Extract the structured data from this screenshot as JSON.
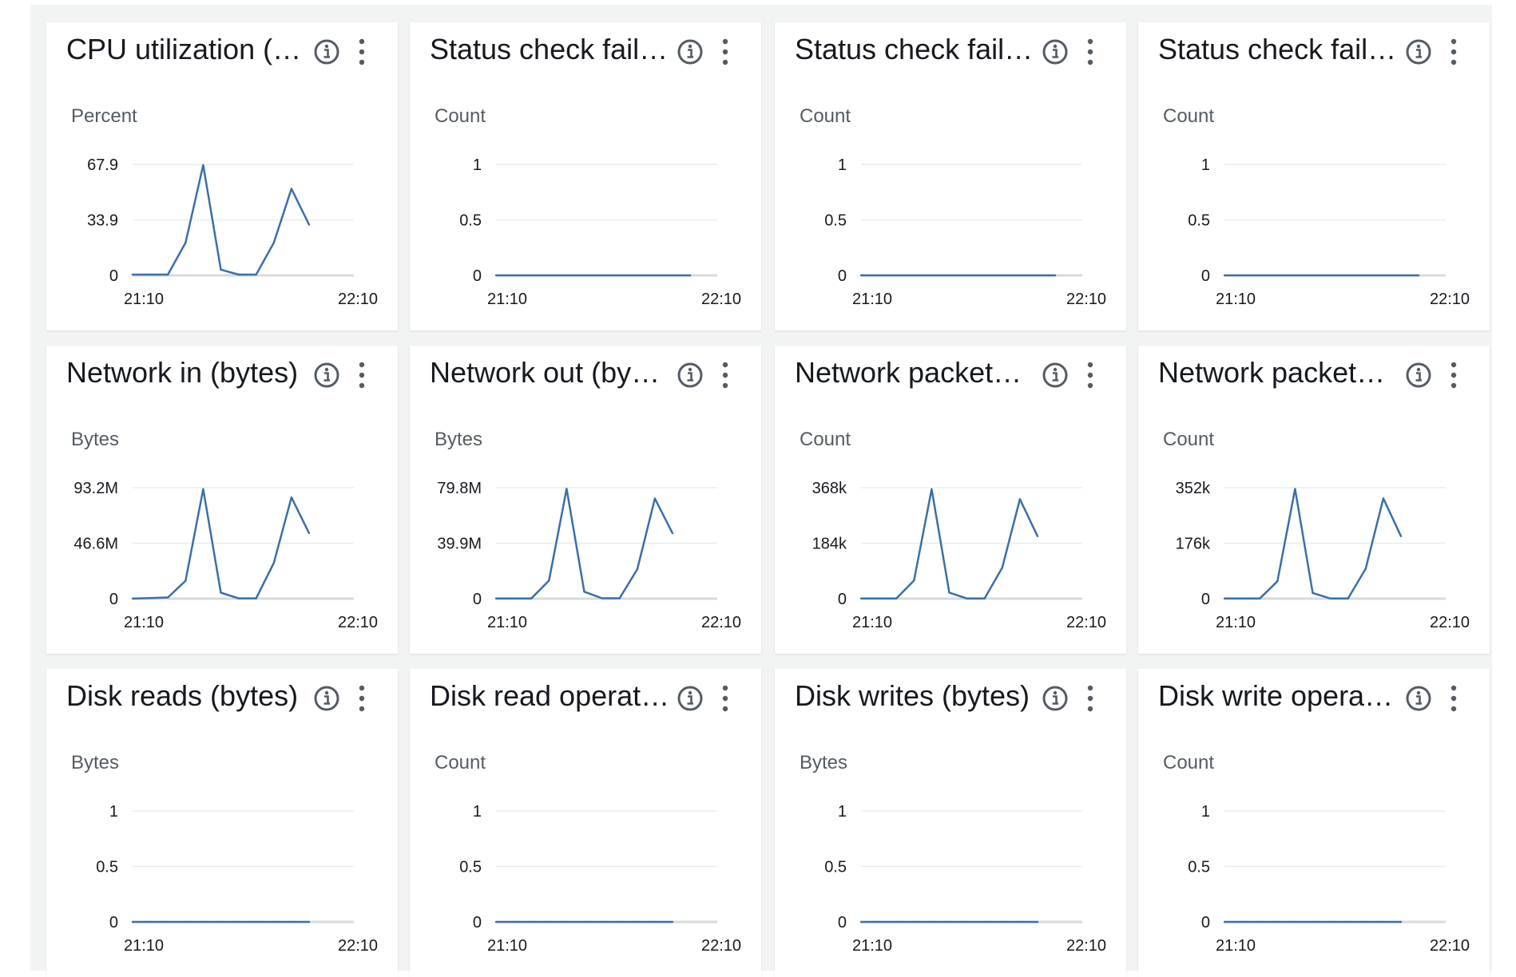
{
  "colors": {
    "series": "#3a6fa8",
    "grid": "#e9ebed",
    "baseline": "#d5dbdb"
  },
  "icons": {
    "info": "info-circle-icon",
    "menu": "vertical-ellipsis-icon"
  },
  "widgets": [
    {
      "title": "CPU utilization (…",
      "unit": "Percent",
      "chart_data": {
        "type": "line",
        "y_ticks": [
          "67.9",
          "33.9",
          "0"
        ],
        "ylim": [
          0,
          67.9
        ],
        "x_ticks": [
          "21:10",
          "22:10"
        ],
        "series": [
          {
            "values": [
              0.5,
              0.5,
              0.5,
              20,
              67.5,
              3.5,
              0.5,
              0.5,
              20,
              53,
              31
            ]
          }
        ]
      }
    },
    {
      "title": "Status check fail…",
      "unit": "Count",
      "chart_data": {
        "type": "line",
        "y_ticks": [
          "1",
          "0.5",
          "0"
        ],
        "ylim": [
          0,
          1
        ],
        "x_ticks": [
          "21:10",
          "22:10"
        ],
        "series": [
          {
            "values": [
              0,
              0,
              0,
              0,
              0,
              0,
              0,
              0,
              0,
              0,
              0,
              0
            ]
          }
        ]
      }
    },
    {
      "title": "Status check fail…",
      "unit": "Count",
      "chart_data": {
        "type": "line",
        "y_ticks": [
          "1",
          "0.5",
          "0"
        ],
        "ylim": [
          0,
          1
        ],
        "x_ticks": [
          "21:10",
          "22:10"
        ],
        "series": [
          {
            "values": [
              0,
              0,
              0,
              0,
              0,
              0,
              0,
              0,
              0,
              0,
              0,
              0
            ]
          }
        ]
      }
    },
    {
      "title": "Status check fail…",
      "unit": "Count",
      "chart_data": {
        "type": "line",
        "y_ticks": [
          "1",
          "0.5",
          "0"
        ],
        "ylim": [
          0,
          1
        ],
        "x_ticks": [
          "21:10",
          "22:10"
        ],
        "series": [
          {
            "values": [
              0,
              0,
              0,
              0,
              0,
              0,
              0,
              0,
              0,
              0,
              0,
              0
            ]
          }
        ]
      }
    },
    {
      "title": "Network in (bytes)",
      "unit": "Bytes",
      "chart_data": {
        "type": "line",
        "y_ticks": [
          "93.2M",
          "46.6M",
          "0"
        ],
        "ylim": [
          0,
          93.2
        ],
        "x_ticks": [
          "21:10",
          "22:10"
        ],
        "series": [
          {
            "values": [
              0.1,
              0.5,
              1,
              15,
              92,
              5,
              0.3,
              0.3,
              30,
              85,
              55
            ]
          }
        ]
      }
    },
    {
      "title": "Network out (by…",
      "unit": "Bytes",
      "chart_data": {
        "type": "line",
        "y_ticks": [
          "79.8M",
          "39.9M",
          "0"
        ],
        "ylim": [
          0,
          79.8
        ],
        "x_ticks": [
          "21:10",
          "22:10"
        ],
        "series": [
          {
            "values": [
              0.1,
              0.1,
              0.1,
              13,
              79,
              5,
              0.3,
              0.3,
              21,
              72,
              47
            ]
          }
        ]
      }
    },
    {
      "title": "Network packet…",
      "unit": "Count",
      "chart_data": {
        "type": "line",
        "y_ticks": [
          "368k",
          "184k",
          "0"
        ],
        "ylim": [
          0,
          368
        ],
        "x_ticks": [
          "21:10",
          "22:10"
        ],
        "series": [
          {
            "values": [
              0.5,
              0.5,
              0.5,
              60,
              363,
              20,
              0.5,
              0.5,
              103,
              330,
              207
            ]
          }
        ]
      }
    },
    {
      "title": "Network packet…",
      "unit": "Count",
      "chart_data": {
        "type": "line",
        "y_ticks": [
          "352k",
          "176k",
          "0"
        ],
        "ylim": [
          0,
          352
        ],
        "x_ticks": [
          "21:10",
          "22:10"
        ],
        "series": [
          {
            "values": [
              0.5,
              0.5,
              0.5,
              55,
              348,
              18,
              0.5,
              0.5,
              95,
              318,
              198
            ]
          }
        ]
      }
    },
    {
      "title": "Disk reads (bytes)",
      "unit": "Bytes",
      "chart_data": {
        "type": "line",
        "y_ticks": [
          "1",
          "0.5",
          "0"
        ],
        "ylim": [
          0,
          1
        ],
        "x_ticks": [
          "21:10",
          "22:10"
        ],
        "series": [
          {
            "values": [
              0,
              0,
              0,
              0,
              0,
              0,
              0,
              0,
              0,
              0,
              0
            ]
          }
        ]
      }
    },
    {
      "title": "Disk read operat…",
      "unit": "Count",
      "chart_data": {
        "type": "line",
        "y_ticks": [
          "1",
          "0.5",
          "0"
        ],
        "ylim": [
          0,
          1
        ],
        "x_ticks": [
          "21:10",
          "22:10"
        ],
        "series": [
          {
            "values": [
              0,
              0,
              0,
              0,
              0,
              0,
              0,
              0,
              0,
              0,
              0
            ]
          }
        ]
      }
    },
    {
      "title": "Disk writes (bytes)",
      "unit": "Bytes",
      "chart_data": {
        "type": "line",
        "y_ticks": [
          "1",
          "0.5",
          "0"
        ],
        "ylim": [
          0,
          1
        ],
        "x_ticks": [
          "21:10",
          "22:10"
        ],
        "series": [
          {
            "values": [
              0,
              0,
              0,
              0,
              0,
              0,
              0,
              0,
              0,
              0,
              0
            ]
          }
        ]
      }
    },
    {
      "title": "Disk write opera…",
      "unit": "Count",
      "chart_data": {
        "type": "line",
        "y_ticks": [
          "1",
          "0.5",
          "0"
        ],
        "ylim": [
          0,
          1
        ],
        "x_ticks": [
          "21:10",
          "22:10"
        ],
        "series": [
          {
            "values": [
              0,
              0,
              0,
              0,
              0,
              0,
              0,
              0,
              0,
              0,
              0
            ]
          }
        ]
      }
    }
  ]
}
